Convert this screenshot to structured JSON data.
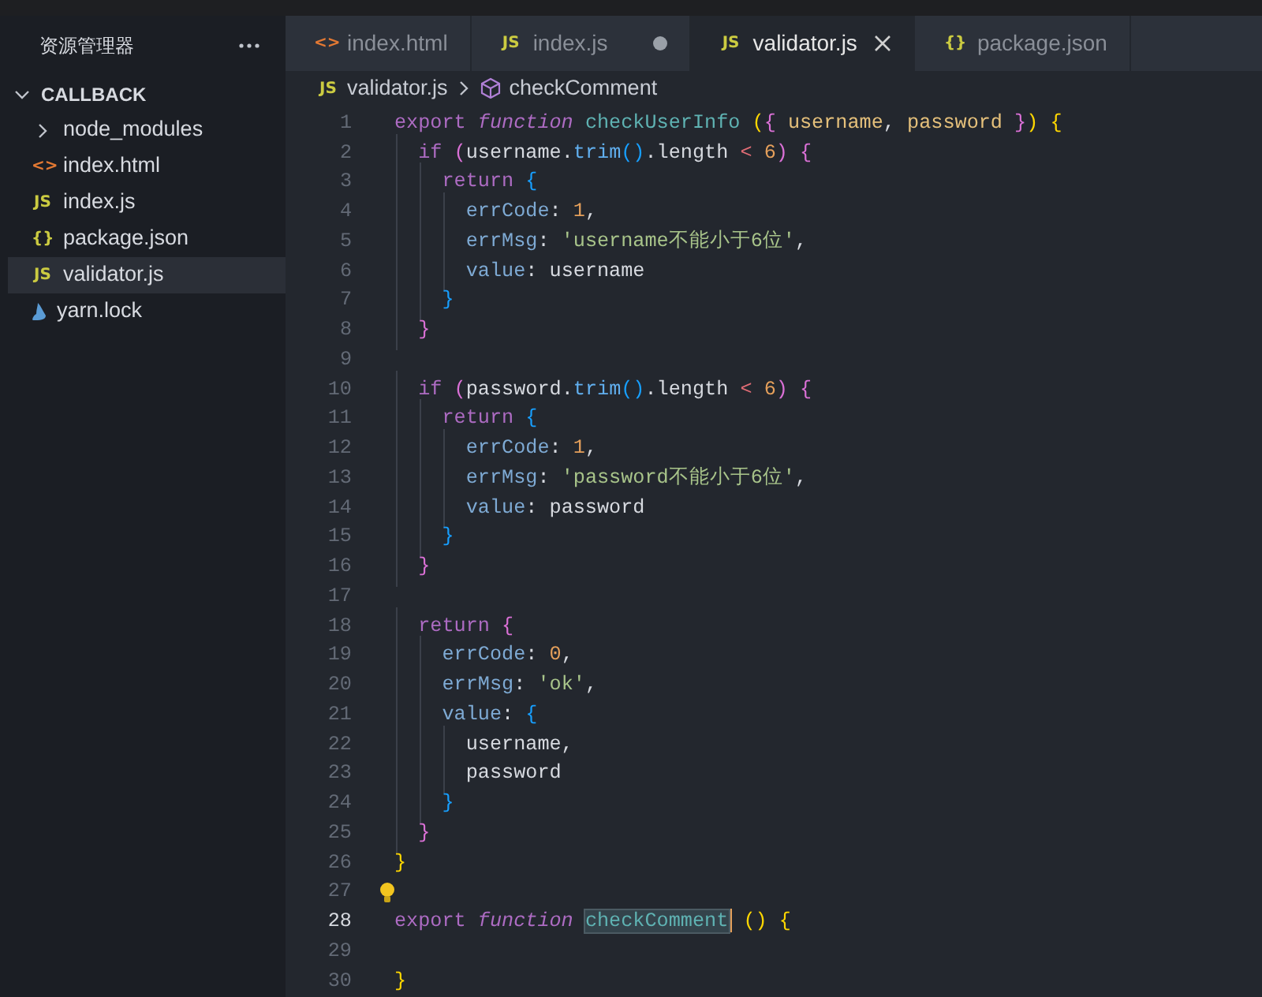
{
  "sidebar": {
    "title": "资源管理器",
    "folder": {
      "name": "CALLBACK",
      "expanded": true
    },
    "items": [
      {
        "name": "node_modules",
        "kind": "folder",
        "selected": false
      },
      {
        "name": "index.html",
        "kind": "html",
        "icon": "<>",
        "selected": false
      },
      {
        "name": "index.js",
        "kind": "js",
        "icon": "JS",
        "selected": false
      },
      {
        "name": "package.json",
        "kind": "json",
        "icon": "{}",
        "selected": false
      },
      {
        "name": "validator.js",
        "kind": "js",
        "icon": "JS",
        "selected": true
      },
      {
        "name": "yarn.lock",
        "kind": "yarn",
        "selected": false
      }
    ]
  },
  "tabs": [
    {
      "label": "index.html",
      "kind": "html",
      "icon": "<>",
      "selected": false,
      "modified": false
    },
    {
      "label": "index.js",
      "kind": "js",
      "icon": "JS",
      "selected": false,
      "modified": true
    },
    {
      "label": "validator.js",
      "kind": "js",
      "icon": "JS",
      "selected": true,
      "modified": false
    },
    {
      "label": "package.json",
      "kind": "json",
      "icon": "{}",
      "selected": false,
      "modified": false
    }
  ],
  "breadcrumb": {
    "file": "validator.js",
    "file_icon": "JS",
    "symbol": "checkComment"
  },
  "lines": [
    {
      "number": "1",
      "tokens": [
        {
          "text": "export ",
          "kind": "kw"
        },
        {
          "text": "function ",
          "kind": "storage"
        },
        {
          "text": "checkUserInfo ",
          "kind": "fn"
        },
        {
          "text": "(",
          "kind": "b1"
        },
        {
          "text": "{ ",
          "kind": "b2"
        },
        {
          "text": "username",
          "kind": "param"
        },
        {
          "text": ", ",
          "kind": "plain"
        },
        {
          "text": "password",
          "kind": "param"
        },
        {
          "text": " }",
          "kind": "b2"
        },
        {
          "text": ")",
          "kind": "b1"
        },
        {
          "text": " {",
          "kind": "b1"
        }
      ]
    },
    {
      "number": "2",
      "tokens": [
        {
          "text": "  if ",
          "kind": "kw"
        },
        {
          "text": "(",
          "kind": "b2"
        },
        {
          "text": "username.",
          "kind": "plain"
        },
        {
          "text": "trim",
          "kind": "method"
        },
        {
          "text": "()",
          "kind": "b3"
        },
        {
          "text": ".length ",
          "kind": "plain"
        },
        {
          "text": "<",
          "kind": "op"
        },
        {
          "text": " 6",
          "kind": "num"
        },
        {
          "text": ")",
          "kind": "b2"
        },
        {
          "text": " {",
          "kind": "b2"
        }
      ]
    },
    {
      "number": "3",
      "tokens": [
        {
          "text": "    return ",
          "kind": "kw"
        },
        {
          "text": "{",
          "kind": "b3"
        }
      ]
    },
    {
      "number": "4",
      "tokens": [
        {
          "text": "      errCode",
          "kind": "prop"
        },
        {
          "text": ": ",
          "kind": "plain"
        },
        {
          "text": "1",
          "kind": "num"
        },
        {
          "text": ",",
          "kind": "plain"
        }
      ]
    },
    {
      "number": "5",
      "tokens": [
        {
          "text": "      errMsg",
          "kind": "prop"
        },
        {
          "text": ": ",
          "kind": "plain"
        },
        {
          "text": "'username不能小于6位'",
          "kind": "str"
        },
        {
          "text": ",",
          "kind": "plain"
        }
      ]
    },
    {
      "number": "6",
      "tokens": [
        {
          "text": "      value",
          "kind": "prop"
        },
        {
          "text": ": username",
          "kind": "plain"
        }
      ]
    },
    {
      "number": "7",
      "tokens": [
        {
          "text": "    }",
          "kind": "b3"
        }
      ]
    },
    {
      "number": "8",
      "tokens": [
        {
          "text": "  }",
          "kind": "b2"
        }
      ]
    },
    {
      "number": "9"
    },
    {
      "number": "10",
      "tokens": [
        {
          "text": "  if ",
          "kind": "kw"
        },
        {
          "text": "(",
          "kind": "b2"
        },
        {
          "text": "password.",
          "kind": "plain"
        },
        {
          "text": "trim",
          "kind": "method"
        },
        {
          "text": "()",
          "kind": "b3"
        },
        {
          "text": ".length ",
          "kind": "plain"
        },
        {
          "text": "<",
          "kind": "op"
        },
        {
          "text": " 6",
          "kind": "num"
        },
        {
          "text": ")",
          "kind": "b2"
        },
        {
          "text": " {",
          "kind": "b2"
        }
      ]
    },
    {
      "number": "11",
      "tokens": [
        {
          "text": "    return ",
          "kind": "kw"
        },
        {
          "text": "{",
          "kind": "b3"
        }
      ]
    },
    {
      "number": "12",
      "tokens": [
        {
          "text": "      errCode",
          "kind": "prop"
        },
        {
          "text": ": ",
          "kind": "plain"
        },
        {
          "text": "1",
          "kind": "num"
        },
        {
          "text": ",",
          "kind": "plain"
        }
      ]
    },
    {
      "number": "13",
      "tokens": [
        {
          "text": "      errMsg",
          "kind": "prop"
        },
        {
          "text": ": ",
          "kind": "plain"
        },
        {
          "text": "'password不能小于6位'",
          "kind": "str"
        },
        {
          "text": ",",
          "kind": "plain"
        }
      ]
    },
    {
      "number": "14",
      "tokens": [
        {
          "text": "      value",
          "kind": "prop"
        },
        {
          "text": ": password",
          "kind": "plain"
        }
      ]
    },
    {
      "number": "15",
      "tokens": [
        {
          "text": "    }",
          "kind": "b3"
        }
      ]
    },
    {
      "number": "16",
      "tokens": [
        {
          "text": "  }",
          "kind": "b2"
        }
      ]
    },
    {
      "number": "17"
    },
    {
      "number": "18",
      "tokens": [
        {
          "text": "  return ",
          "kind": "kw"
        },
        {
          "text": "{",
          "kind": "b2"
        }
      ]
    },
    {
      "number": "19",
      "tokens": [
        {
          "text": "    errCode",
          "kind": "prop"
        },
        {
          "text": ": ",
          "kind": "plain"
        },
        {
          "text": "0",
          "kind": "num"
        },
        {
          "text": ",",
          "kind": "plain"
        }
      ]
    },
    {
      "number": "20",
      "tokens": [
        {
          "text": "    errMsg",
          "kind": "prop"
        },
        {
          "text": ": ",
          "kind": "plain"
        },
        {
          "text": "'ok'",
          "kind": "str"
        },
        {
          "text": ",",
          "kind": "plain"
        }
      ]
    },
    {
      "number": "21",
      "tokens": [
        {
          "text": "    value",
          "kind": "prop"
        },
        {
          "text": ": ",
          "kind": "plain"
        },
        {
          "text": "{",
          "kind": "b3"
        }
      ]
    },
    {
      "number": "22",
      "tokens": [
        {
          "text": "      username,",
          "kind": "plain"
        }
      ]
    },
    {
      "number": "23",
      "tokens": [
        {
          "text": "      password",
          "kind": "plain"
        }
      ]
    },
    {
      "number": "24",
      "tokens": [
        {
          "text": "    }",
          "kind": "b3"
        }
      ]
    },
    {
      "number": "25",
      "tokens": [
        {
          "text": "  }",
          "kind": "b2"
        }
      ]
    },
    {
      "number": "26",
      "tokens": [
        {
          "text": "}",
          "kind": "b1"
        }
      ]
    },
    {
      "number": "27",
      "lightbulb": true
    },
    {
      "number": "28",
      "current": true,
      "tokens": [
        {
          "text": "export ",
          "kind": "kw"
        },
        {
          "text": "function ",
          "kind": "storage"
        },
        {
          "text": "checkComment",
          "kind": "fn",
          "highlight": true
        },
        {
          "text": " ()",
          "kind": "b1"
        },
        {
          "text": " {",
          "kind": "b1"
        }
      ]
    },
    {
      "number": "29"
    },
    {
      "number": "30",
      "tokens": [
        {
          "text": "}",
          "kind": "b1"
        }
      ]
    }
  ]
}
